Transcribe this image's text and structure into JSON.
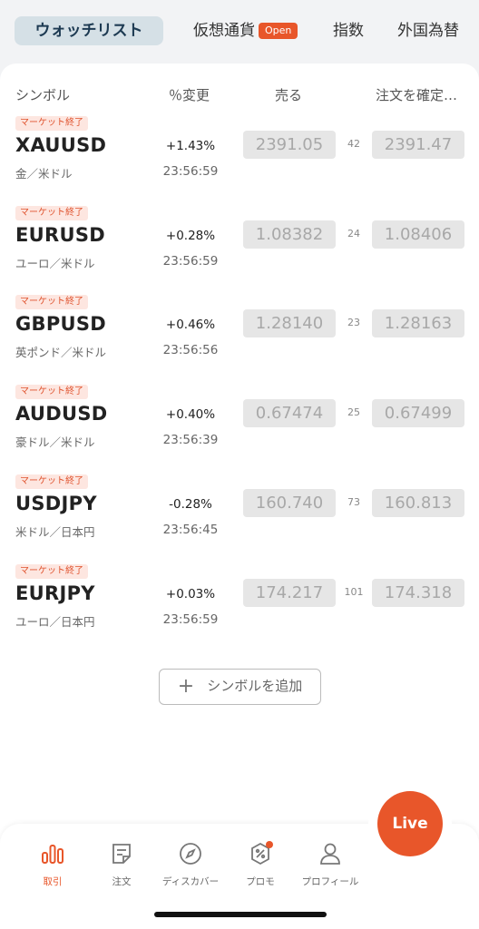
{
  "tabs": {
    "watchlist": "ウォッチリスト",
    "crypto": "仮想通貨",
    "crypto_badge": "Open",
    "indices": "指数",
    "forex": "外国為替"
  },
  "columns": {
    "symbol": "シンボル",
    "change": "％変更",
    "sell": "売る",
    "order": "注文を確定…"
  },
  "rows": [
    {
      "badge": "マーケット終了",
      "symbol": "XAUUSD",
      "desc": "金／米ドル",
      "change": "+1.43%",
      "time": "23:56:59",
      "sell": "2391.05",
      "spread": "42",
      "buy": "2391.47"
    },
    {
      "badge": "マーケット終了",
      "symbol": "EURUSD",
      "desc": "ユーロ／米ドル",
      "change": "+0.28%",
      "time": "23:56:59",
      "sell": "1.08382",
      "spread": "24",
      "buy": "1.08406"
    },
    {
      "badge": "マーケット終了",
      "symbol": "GBPUSD",
      "desc": "英ポンド／米ドル",
      "change": "+0.46%",
      "time": "23:56:56",
      "sell": "1.28140",
      "spread": "23",
      "buy": "1.28163"
    },
    {
      "badge": "マーケット終了",
      "symbol": "AUDUSD",
      "desc": "豪ドル／米ドル",
      "change": "+0.40%",
      "time": "23:56:39",
      "sell": "0.67474",
      "spread": "25",
      "buy": "0.67499"
    },
    {
      "badge": "マーケット終了",
      "symbol": "USDJPY",
      "desc": "米ドル／日本円",
      "change": "-0.28%",
      "time": "23:56:45",
      "sell": "160.740",
      "spread": "73",
      "buy": "160.813"
    },
    {
      "badge": "マーケット終了",
      "symbol": "EURJPY",
      "desc": "ユーロ／日本円",
      "change": "+0.03%",
      "time": "23:56:59",
      "sell": "174.217",
      "spread": "101",
      "buy": "174.318"
    }
  ],
  "add_symbol": {
    "plus": "+",
    "label": "シンボルを追加"
  },
  "live_button": "Live",
  "nav": {
    "trade": "取引",
    "orders": "注文",
    "discover": "ディスカバー",
    "promo": "プロモ",
    "profile": "プロフィール"
  },
  "colors": {
    "accent": "#e8562a",
    "active_tab_bg": "#d5e0e6",
    "badge_bg": "#fde6e0",
    "price_box_bg": "#e6e6e6"
  },
  "icons": {
    "trade": "bar-chart-icon",
    "orders": "note-icon",
    "discover": "compass-icon",
    "promo": "discount-tag-icon",
    "profile": "user-icon"
  }
}
